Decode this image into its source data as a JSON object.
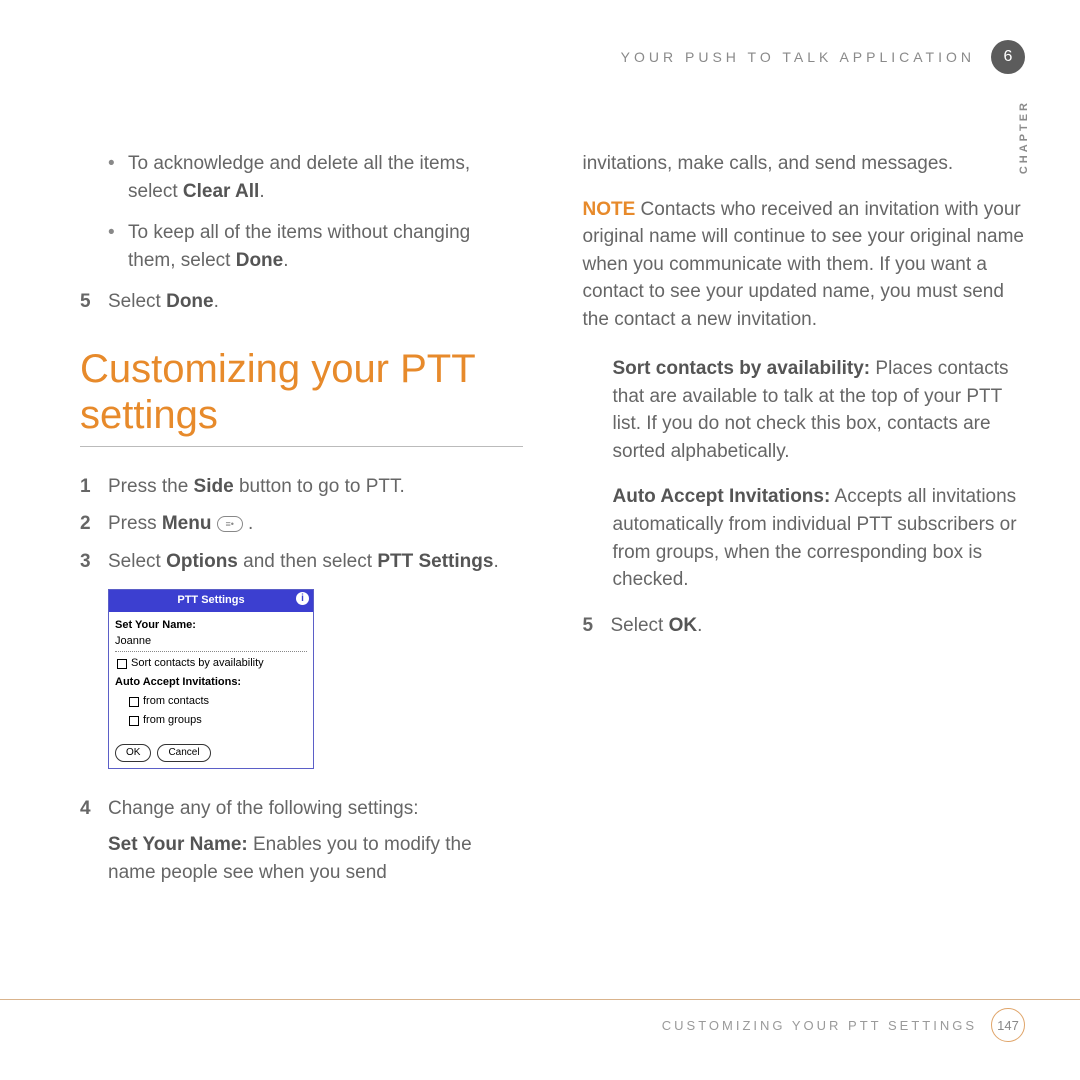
{
  "header": {
    "section": "YOUR PUSH TO TALK APPLICATION",
    "chapter_num": "6",
    "chapter_label": "CHAPTER"
  },
  "left": {
    "bullets": [
      {
        "pre": "To acknowledge and delete all the items, select ",
        "bold": "Clear All",
        "post": "."
      },
      {
        "pre": "To keep all of the items without changing them, select ",
        "bold": "Done",
        "post": "."
      }
    ],
    "step5_num": "5",
    "step5_pre": "Select ",
    "step5_bold": "Done",
    "step5_post": ".",
    "heading": "Customizing your PTT settings",
    "s1_num": "1",
    "s1_pre": "Press the ",
    "s1_bold": "Side",
    "s1_post": " button to go to PTT.",
    "s2_num": "2",
    "s2_pre": "Press ",
    "s2_bold": "Menu",
    "s2_post": " .",
    "s3_num": "3",
    "s3_pre": "Select ",
    "s3_bold1": "Options",
    "s3_mid": " and then select ",
    "s3_bold2": "PTT Settings",
    "s3_post": ".",
    "s4_num": "4",
    "s4_text": "Change any of the following settings:",
    "s4_bold": "Set Your Name:",
    "s4_desc": " Enables you to modify the name people see when you send "
  },
  "shot": {
    "title": "PTT Settings",
    "name_label": "Set Your Name:",
    "name_value": "Joanne",
    "sort_label": "Sort contacts by availability",
    "auto_label": "Auto Accept Invitations:",
    "from_contacts": "from contacts",
    "from_groups": "from groups",
    "ok": "OK",
    "cancel": "Cancel"
  },
  "right": {
    "cont": "invitations, make calls, and send messages.",
    "note_label": "NOTE",
    "note_text": " Contacts who received an invitation with your original name will continue to see your original name when you communicate with them. If you want a contact to see your updated name, you must send the contact a new invitation.",
    "sort_bold": "Sort contacts by availability:",
    "sort_text": " Places contacts that are available to talk at the top of your PTT list. If you do not check this box, contacts are sorted alphabetically.",
    "auto_bold": "Auto Accept Invitations:",
    "auto_text": " Accepts all invitations automatically from individual PTT subscribers or from groups, when the corresponding box is checked.",
    "s5_num": "5",
    "s5_pre": "Select ",
    "s5_bold": "OK",
    "s5_post": "."
  },
  "footer": {
    "text": "CUSTOMIZING YOUR PTT SETTINGS",
    "page": "147"
  }
}
